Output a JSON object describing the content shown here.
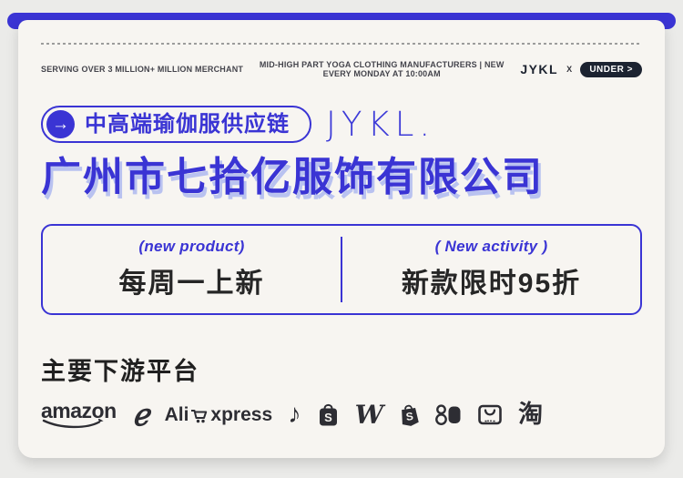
{
  "colors": {
    "accent_blue": "#3a34d4",
    "accent_light_blue": "#b9c2f0",
    "card_bg": "#f7f5f1",
    "page_bg": "#ebebe9",
    "dark_text": "#2d2d33",
    "badge_bg": "#1c2331"
  },
  "header": {
    "left": "SERVING OVER 3 MILLION+  MILLION MERCHANT",
    "center": "MID-HIGH PART YOGA CLOTHING MANUFACTURERS  | NEW EVERY MONDAY AT 10:00AM",
    "brand": "JYKL",
    "collab_x": "X",
    "badge": "UNDER >"
  },
  "brand_row": {
    "arrow": "→",
    "pill_label": "中高端瑜伽服供应链",
    "logo": "JYKL."
  },
  "title": "广州市七拾亿服饰有限公司",
  "info_box": {
    "left": {
      "subtitle": "(new product)",
      "text": "每周一上新"
    },
    "right": {
      "subtitle": "( New activity )",
      "text": "新款限时95折"
    }
  },
  "platforms": {
    "heading": "主要下游平台",
    "items": [
      {
        "name": "amazon",
        "label": "amazon"
      },
      {
        "name": "alibaba",
        "glyph": "ℯ"
      },
      {
        "name": "aliexpress",
        "pre": "Ali",
        "post": "xpress"
      },
      {
        "name": "tiktok",
        "glyph": "♪"
      },
      {
        "name": "shopee",
        "letter": "S"
      },
      {
        "name": "wish",
        "letter": "W"
      },
      {
        "name": "shopify",
        "letter": "S"
      },
      {
        "name": "kuaishou"
      },
      {
        "name": "shop-bag-smile"
      },
      {
        "name": "taobao",
        "label": "淘"
      }
    ]
  }
}
